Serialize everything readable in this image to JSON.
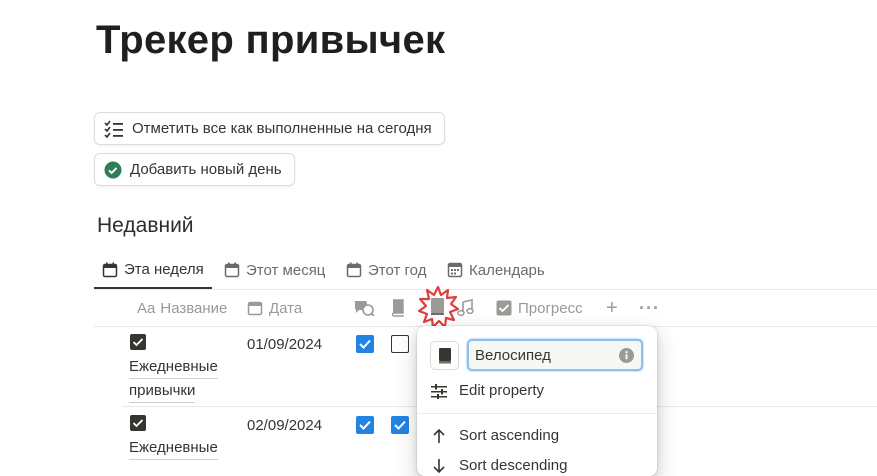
{
  "page": {
    "title": "Трекер привычек"
  },
  "buttons": {
    "mark_all": "Отметить все как выполненные на сегодня",
    "add_day": "Добавить новый день"
  },
  "section": {
    "title": "Недавний"
  },
  "tabs": [
    {
      "label": "Эта неделя",
      "active": true
    },
    {
      "label": "Этот месяц"
    },
    {
      "label": "Этот год"
    },
    {
      "label": "Календарь"
    }
  ],
  "columns": {
    "name": "Название",
    "name_prefix": "Aa",
    "date": "Дата",
    "progress": "Прогресс"
  },
  "rows": [
    {
      "name_line1": "Ежедневные",
      "name_line2": "привычки",
      "date": "01/09/2024",
      "habit1_done": true,
      "habit2_done": false
    },
    {
      "name_line1": "Ежедневные",
      "name_line2": "",
      "date": "02/09/2024",
      "habit1_done": true,
      "habit2_done": true
    }
  ],
  "popup": {
    "property_name": "Велосипед",
    "icon": "book-icon",
    "items": [
      "Edit property",
      "Sort ascending",
      "Sort descending"
    ]
  },
  "colors": {
    "accent": "#2383e2",
    "check_green": "#2f7d5b",
    "highlight_red": "#e03e3e"
  }
}
